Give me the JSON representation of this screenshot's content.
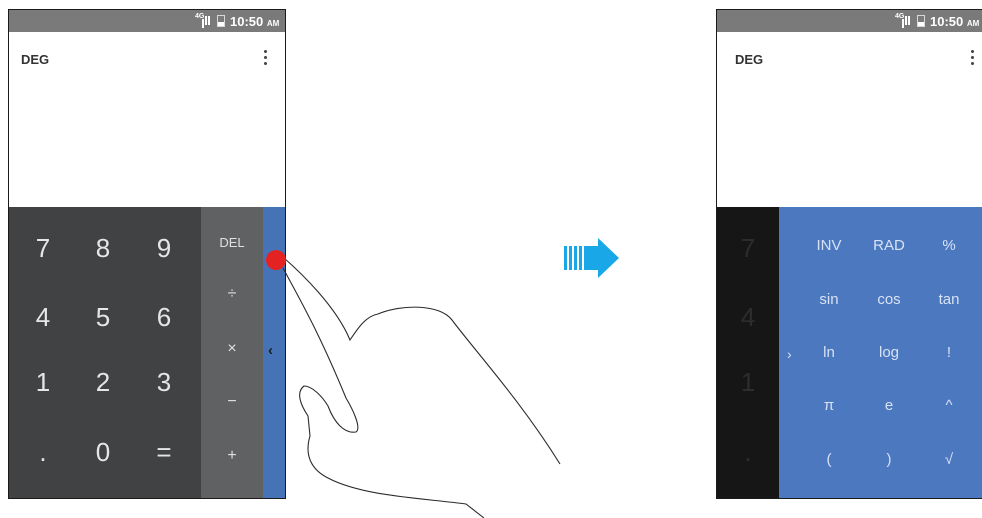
{
  "status_bar": {
    "network": "4G",
    "time": "10:50",
    "ampm": "AM"
  },
  "display": {
    "angle_mode": "DEG"
  },
  "icons": {
    "more_menu": "more-vert-icon",
    "collapse": "chevron-left-icon",
    "expand": "chevron-right-icon",
    "arrow": "arrow-right-icon",
    "hand": "hand-swipe-icon"
  },
  "numpad": {
    "rows": [
      [
        "7",
        "8",
        "9"
      ],
      [
        "4",
        "5",
        "6"
      ],
      [
        "1",
        "2",
        "3"
      ],
      [
        ".",
        "0",
        "="
      ]
    ]
  },
  "operators": [
    "DEL",
    "÷",
    "×",
    "−",
    "+"
  ],
  "advanced": {
    "rows": [
      [
        "INV",
        "RAD",
        "%"
      ],
      [
        "sin",
        "cos",
        "tan"
      ],
      [
        "ln",
        "log",
        "!"
      ],
      [
        "π",
        "e",
        "^"
      ],
      [
        "(",
        ")",
        "√"
      ]
    ]
  },
  "colors": {
    "numpad_bg": "#404244",
    "operator_bg": "#5f6163",
    "advanced_bg": "#4c78c0",
    "tab_bg": "#4673b6",
    "status_bar": "#7a7a7a",
    "touch_point": "#e52222",
    "arrow": "#1aa7e8"
  }
}
